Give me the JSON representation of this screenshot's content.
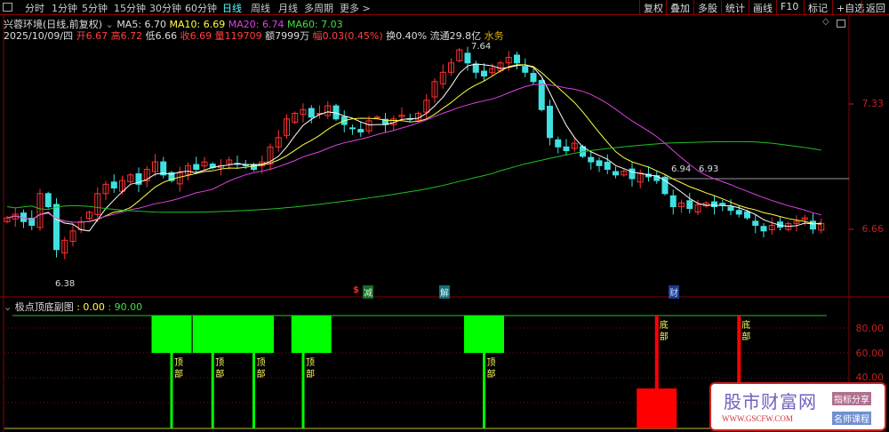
{
  "toolbar": {
    "tabs": [
      "分时",
      "1分钟",
      "5分钟",
      "15分钟",
      "30分钟",
      "60分钟",
      "日线",
      "周线",
      "月线",
      "多周期",
      "更多 >"
    ],
    "active": "日线",
    "right_buttons": [
      "复权",
      "叠加",
      "多股",
      "统计",
      "画线",
      "F10",
      "标记",
      "+自选",
      "返回"
    ]
  },
  "header": {
    "title": "兴蓉环境(日线,前复权)",
    "ma5": "MA5: 6.70",
    "ma10": "MA10: 6.69",
    "ma20": "MA20: 6.74",
    "ma60": "MA60: 7.03",
    "date": "2025/10/09/四",
    "open": "开6.67",
    "high": "高6.72",
    "low": "低6.66",
    "close": "收6.69",
    "volume": "量119709",
    "amount": "额7999万",
    "change": "幅0.03(0.45%)",
    "turnover": "换0.40%",
    "float": "流通29.8亿",
    "sector": "水务"
  },
  "main_axis": [
    "7.33",
    "6.66"
  ],
  "annotations": {
    "high": "7.64",
    "low": "6.38",
    "last": "6.94",
    "ref": "6.93"
  },
  "event_tags": [
    "$",
    "减",
    "解",
    "财"
  ],
  "chart_data": {
    "type": "candlestick",
    "closes": [
      6.72,
      6.74,
      6.7,
      6.68,
      6.85,
      6.78,
      6.55,
      6.6,
      6.65,
      6.7,
      6.75,
      6.85,
      6.9,
      6.88,
      6.92,
      6.95,
      6.9,
      6.98,
      7.02,
      6.95,
      6.92,
      6.96,
      7.0,
      6.98,
      7.02,
      6.99,
      7.0,
      7.03,
      7.01,
      7.0,
      6.98,
      7.02,
      7.1,
      7.15,
      7.25,
      7.28,
      7.3,
      7.26,
      7.28,
      7.32,
      7.25,
      7.22,
      7.2,
      7.18,
      7.24,
      7.26,
      7.22,
      7.25,
      7.27,
      7.25,
      7.28,
      7.35,
      7.45,
      7.5,
      7.55,
      7.62,
      7.55,
      7.5,
      7.48,
      7.52,
      7.55,
      7.58,
      7.55,
      7.5,
      7.45,
      7.3,
      7.15,
      7.1,
      7.08,
      7.12,
      7.05,
      7.02,
      7.0,
      6.98,
      6.95,
      6.97,
      6.93,
      6.96,
      6.94,
      6.92,
      6.85,
      6.78,
      6.8,
      6.77,
      6.79,
      6.8,
      6.78,
      6.79,
      6.76,
      6.74,
      6.72,
      6.68,
      6.65,
      6.68,
      6.67,
      6.69,
      6.7,
      6.72,
      6.66,
      6.69
    ],
    "ma_colors": {
      "ma5": "#ffffff",
      "ma10": "#ffff40",
      "ma20": "#e040e0",
      "ma60": "#20c020"
    },
    "up_color": "#ff3030",
    "down_color": "#40e0e0"
  },
  "sub": {
    "title": "极点顶底副图",
    "v1": ": 0.00",
    "v2": ": 90.00",
    "axis": [
      "80.00",
      "60.00",
      "40.00"
    ],
    "top_label": "顶部",
    "bottom_label": "底部",
    "top_blocks": [
      [
        18,
        22
      ],
      [
        23,
        32
      ],
      [
        35,
        39
      ],
      [
        56,
        60
      ]
    ],
    "top_lines": [
      20,
      25,
      30,
      36,
      58
    ],
    "bottom_lines": [
      79,
      89
    ],
    "bottom_block": [
      77,
      81
    ]
  },
  "watermark": {
    "title": "股市财富网",
    "url": "WWW.GSCFW.COM",
    "badge1": "指标分享",
    "badge2": "名师课程"
  }
}
